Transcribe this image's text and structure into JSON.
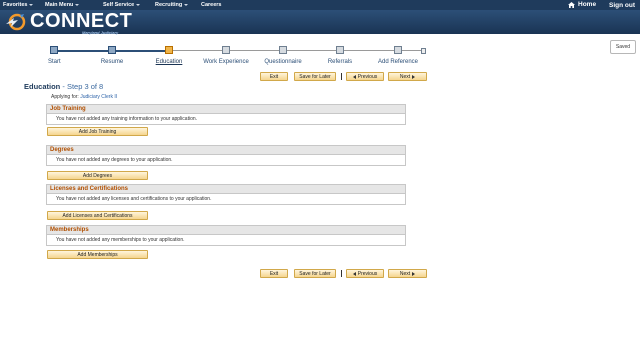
{
  "nav": {
    "items": [
      {
        "label": "Favorites",
        "has_menu": true
      },
      {
        "label": "Main Menu",
        "has_menu": true
      },
      {
        "label": "Self Service",
        "has_menu": true
      },
      {
        "label": "Recruiting",
        "has_menu": true
      },
      {
        "label": "Careers",
        "has_menu": false
      }
    ],
    "home_label": "Home",
    "signout_label": "Sign out"
  },
  "brand": {
    "name": "CONNECT",
    "tagline": "Maryland Judiciary"
  },
  "saved_label": "Saved",
  "train": {
    "steps": [
      {
        "label": "Start",
        "state": "done"
      },
      {
        "label": "Resume",
        "state": "done"
      },
      {
        "label": "Education",
        "state": "current"
      },
      {
        "label": "Work Experience",
        "state": "todo"
      },
      {
        "label": "Questionnaire",
        "state": "todo"
      },
      {
        "label": "Referrals",
        "state": "todo"
      },
      {
        "label": "Add Reference",
        "state": "todo"
      }
    ]
  },
  "buttons": {
    "exit": "Exit",
    "save_later": "Save for Later",
    "previous": "Previous",
    "next": "Next"
  },
  "page": {
    "title": "Education",
    "step_text": "- Step 3 of 8",
    "applying_prefix": "Applying for:",
    "job_title": "Judiciary Clerk II"
  },
  "sections": [
    {
      "title": "Job Training",
      "message": "You have not added any training information to your application.",
      "button": "Add Job Training"
    },
    {
      "title": "Degrees",
      "message": "You have not added any degrees to your application.",
      "button": "Add Degrees"
    },
    {
      "title": "Licenses and Certifications",
      "message": "You have not added any licenses and certifications to your application.",
      "button": "Add Licenses and Certifications"
    },
    {
      "title": "Memberships",
      "message": "You have not added any memberships to your application.",
      "button": "Add Memberships"
    }
  ],
  "colors": {
    "nav_bg": "#1f3b5c",
    "banner": "#2c4f77",
    "section_title": "#b14f00",
    "button_fill": "#f5d58e",
    "current_step": "#f0b54a"
  }
}
